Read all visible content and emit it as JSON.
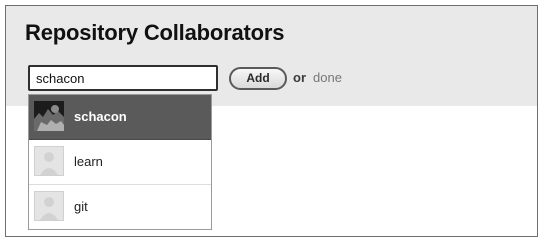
{
  "dialog": {
    "title": "Repository Collaborators"
  },
  "search": {
    "value": "schacon"
  },
  "actions": {
    "add_label": "Add",
    "or_text": "or",
    "done_label": "done"
  },
  "suggestions": [
    {
      "login": "schacon",
      "selected": true,
      "avatar": "user-photo"
    },
    {
      "login": "learn",
      "selected": false,
      "avatar": "default-avatar"
    },
    {
      "login": "git",
      "selected": false,
      "avatar": "default-avatar"
    }
  ]
}
